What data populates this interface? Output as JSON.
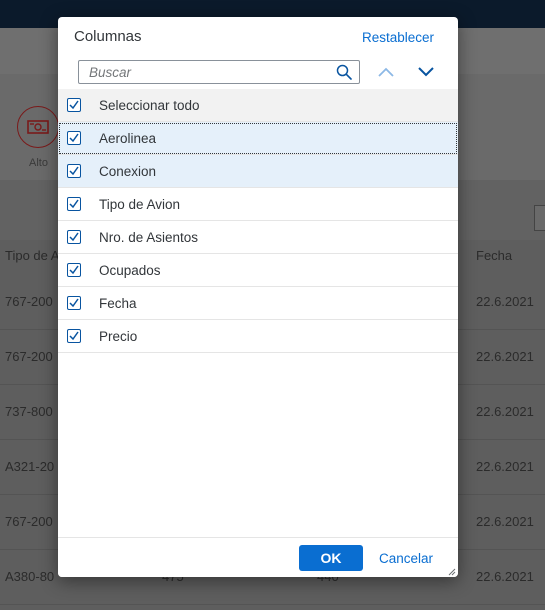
{
  "background": {
    "icon_label": "Alto",
    "table_headers": {
      "col1": "Tipo de A",
      "fecha": "Fecha"
    },
    "rows": [
      {
        "tipo": "767-200",
        "mid1": "",
        "mid2": "",
        "fecha": "22.6.2021"
      },
      {
        "tipo": "767-200",
        "mid1": "",
        "mid2": "",
        "fecha": "22.6.2021"
      },
      {
        "tipo": "737-800",
        "mid1": "",
        "mid2": "",
        "fecha": "22.6.2021"
      },
      {
        "tipo": "A321-20",
        "mid1": "",
        "mid2": "",
        "fecha": "22.6.2021"
      },
      {
        "tipo": "767-200",
        "mid1": "",
        "mid2": "",
        "fecha": "22.6.2021"
      },
      {
        "tipo": "A380-80",
        "mid1": "475",
        "mid2": "440",
        "fecha": "22.6.2021"
      }
    ]
  },
  "dialog": {
    "title": "Columnas",
    "reset_label": "Restablecer",
    "search_placeholder": "Buscar",
    "select_all_label": "Seleccionar todo",
    "items": [
      {
        "label": "Aerolinea",
        "checked": true
      },
      {
        "label": "Conexion",
        "checked": true
      },
      {
        "label": "Tipo de Avion",
        "checked": true
      },
      {
        "label": "Nro. de Asientos",
        "checked": true
      },
      {
        "label": "Ocupados",
        "checked": true
      },
      {
        "label": "Fecha",
        "checked": true
      },
      {
        "label": "Precio",
        "checked": true
      }
    ],
    "ok_label": "OK",
    "cancel_label": "Cancelar"
  },
  "colors": {
    "accent": "#0a6ed1",
    "checkbox_border": "#0854a0",
    "selected_row": "#e5f0fa",
    "select_all_row": "#f2f2f2",
    "overlay_background": "#5c5c5c"
  },
  "icons": {
    "search": "search-icon",
    "move_up": "chevron-up-icon",
    "move_down": "chevron-down-icon",
    "checkbox": "checkmark-icon",
    "background_app": "money-bill-icon",
    "resize": "resize-handle-icon"
  }
}
